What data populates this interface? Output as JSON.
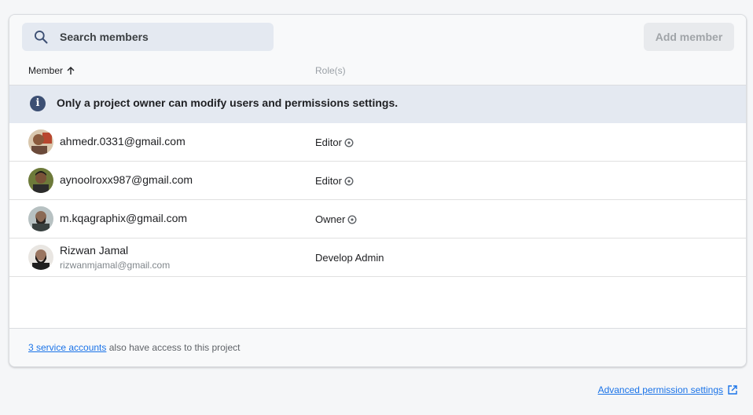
{
  "search": {
    "placeholder": "Search members"
  },
  "toolbar": {
    "add_member_label": "Add member"
  },
  "table": {
    "member_header": "Member",
    "role_header": "Role(s)"
  },
  "notice": {
    "text": "Only a project owner can modify users and permissions settings."
  },
  "members": [
    {
      "email": "ahmedr.0331@gmail.com",
      "role": "Editor"
    },
    {
      "email": "aynoolroxx987@gmail.com",
      "role": "Editor"
    },
    {
      "email": "m.kqagraphix@gmail.com",
      "role": "Owner"
    },
    {
      "name": "Rizwan Jamal",
      "email": "rizwanmjamal@gmail.com",
      "role": "Develop Admin"
    }
  ],
  "footer": {
    "service_accounts_link": "3 service accounts",
    "service_accounts_text": " also have access to this project"
  },
  "advanced_link": "Advanced permission settings",
  "icons": {
    "search": "search-icon",
    "sort": "arrow-up-icon",
    "info": "info-icon",
    "role_info": "help-circle-icon",
    "external": "open-in-new-icon"
  },
  "colors": {
    "accent": "#1a73e8",
    "notice_bg": "#e4e9f1",
    "info_icon": "#3c4f73"
  }
}
